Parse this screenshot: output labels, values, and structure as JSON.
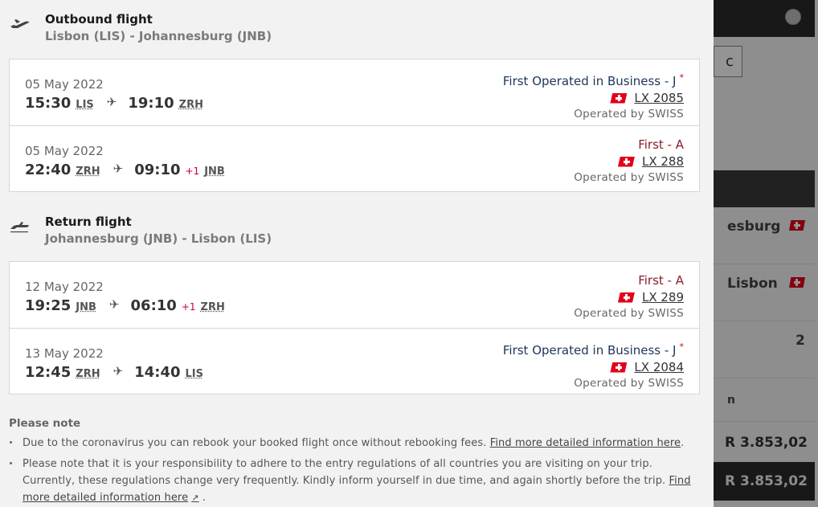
{
  "background": {
    "box_char": "c",
    "rows": [
      "esburg",
      "Lisbon"
    ],
    "count": "2",
    "n_text": "n",
    "prices": [
      "R 3.853,02",
      "R 3.853,02"
    ]
  },
  "outbound": {
    "title": "Outbound flight",
    "route": "Lisbon (LIS) - Johannesburg (JNB)",
    "segments": [
      {
        "date": "05 May 2022",
        "dep_time": "15:30",
        "dep_code": "LIS",
        "arr_time": "19:10",
        "arr_plus": "",
        "arr_code": "ZRH",
        "cabin": "First Operated in Business - J",
        "cabin_mark": "*",
        "flight": "LX 2085",
        "operated": "Operated by SWISS"
      },
      {
        "date": "05 May 2022",
        "dep_time": "22:40",
        "dep_code": "ZRH",
        "arr_time": "09:10",
        "arr_plus": "+1",
        "arr_code": "JNB",
        "cabin": "First - A",
        "cabin_mark": "",
        "flight": "LX 288",
        "operated": "Operated by SWISS"
      }
    ]
  },
  "return": {
    "title": "Return flight",
    "route": "Johannesburg (JNB) - Lisbon (LIS)",
    "segments": [
      {
        "date": "12 May 2022",
        "dep_time": "19:25",
        "dep_code": "JNB",
        "arr_time": "06:10",
        "arr_plus": "+1",
        "arr_code": "ZRH",
        "cabin": "First - A",
        "cabin_mark": "",
        "flight": "LX 289",
        "operated": "Operated by SWISS"
      },
      {
        "date": "13 May 2022",
        "dep_time": "12:45",
        "dep_code": "ZRH",
        "arr_time": "14:40",
        "arr_plus": "",
        "arr_code": "LIS",
        "cabin": "First Operated in Business - J",
        "cabin_mark": "*",
        "flight": "LX 2084",
        "operated": "Operated by SWISS"
      }
    ]
  },
  "note": {
    "title": "Please note",
    "item1_text": "Due to the coronavirus you can rebook your booked flight once without rebooking fees.",
    "item1_link": "Find more detailed information here",
    "item1_end": ".",
    "item2_text": "Please note that it is your responsibility to adhere to the entry regulations of all countries you are visiting on your trip. Currently, these regulations change very frequently. Kindly inform yourself in due time, and again shortly before the trip.",
    "item2_link": "Find more detailed information here",
    "item2_end": "."
  },
  "icons": {
    "arrow": "✈",
    "external": "↗"
  },
  "colors": {
    "swiss_red": "#e2001a",
    "business_blue": "#1d3557",
    "first_red": "#8a1c2b"
  }
}
